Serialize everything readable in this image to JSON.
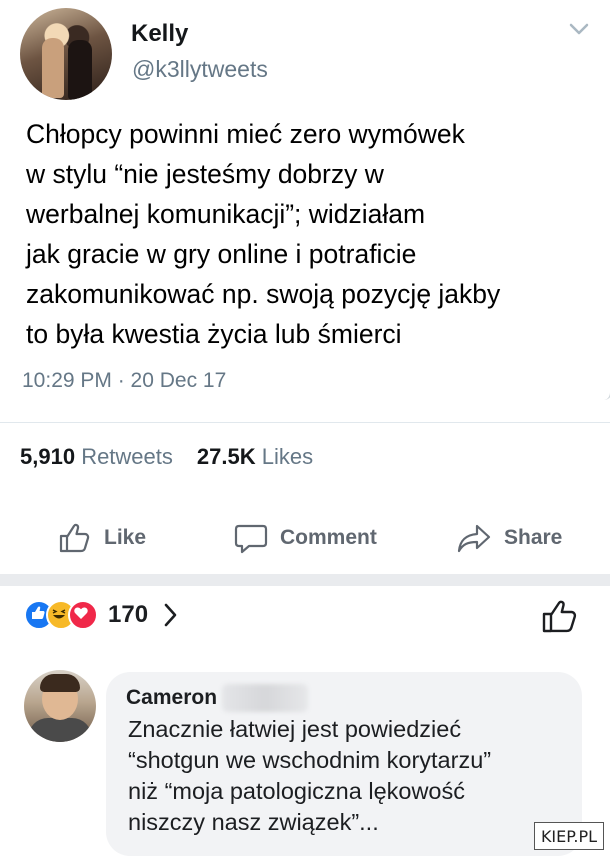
{
  "tweet": {
    "user_name": "Kelly",
    "user_handle": "@k3llytweets",
    "text_lines": [
      "Chłopcy powinni mieć zero wymówek",
      "w stylu “nie jesteśmy dobrzy w",
      "werbalnej komunikacji”; widziałam",
      "jak gracie w gry online i potraficie",
      "zakomunikować np. swoją pozycję jakby",
      "to była kwestia życia lub śmierci"
    ],
    "timestamp": "10:29 PM · 20 Dec 17",
    "retweets_count": "5,910",
    "retweets_label": "Retweets",
    "likes_count": "27.5K",
    "likes_label": "Likes"
  },
  "facebook": {
    "actions": {
      "like": "Like",
      "comment": "Comment",
      "share": "Share"
    },
    "reaction_count": "170",
    "colors": {
      "like": "#1877f2",
      "haha": "#f7b928",
      "love": "#f02849"
    }
  },
  "comment": {
    "author": "Cameron",
    "text_lines": [
      "Znacznie łatwiej jest powiedzieć",
      "“shotgun we wschodnim korytarzu”",
      "niż “moja patologiczna lękowość",
      "niszczy nasz związek”..."
    ]
  },
  "watermark": {
    "text": "KIEP.PL"
  }
}
